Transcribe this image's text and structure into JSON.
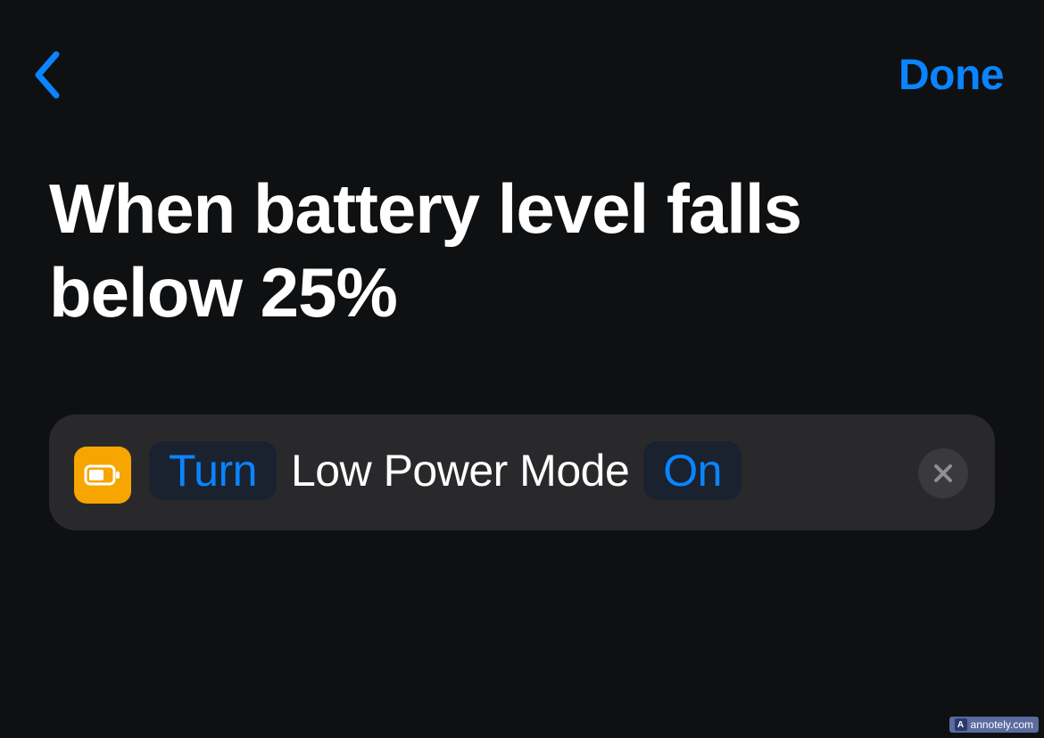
{
  "header": {
    "done_label": "Done"
  },
  "title": "When battery level falls below 25%",
  "action": {
    "verb_token": "Turn",
    "subject_label": "Low Power Mode",
    "state_token": "On",
    "icon_name": "battery-icon"
  },
  "watermark": {
    "text": "annotely.com",
    "icon_letter": "A"
  },
  "colors": {
    "accent": "#0a84ff",
    "action_icon_bg": "#f7a500"
  }
}
